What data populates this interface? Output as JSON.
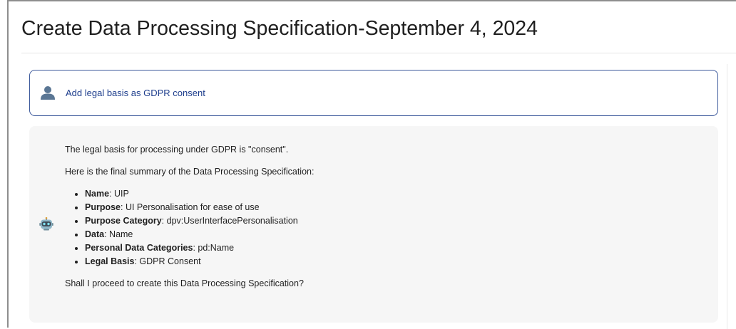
{
  "page": {
    "title": "Create Data Processing Specification-September 4, 2024"
  },
  "user_message": {
    "avatar_icon": "user-silhouette-icon",
    "text": "Add legal basis as GDPR consent"
  },
  "bot_message": {
    "avatar_icon": "robot-icon",
    "intro": "The legal basis for processing under GDPR is \"consent\".",
    "summary_intro": "Here is the final summary of the Data Processing Specification:",
    "items": [
      {
        "label": "Name",
        "value": ": UIP"
      },
      {
        "label": "Purpose",
        "value": ": UI Personalisation for ease of use"
      },
      {
        "label": "Purpose Category",
        "value": ": dpv:UserInterfacePersonalisation"
      },
      {
        "label": "Data",
        "value": ": Name"
      },
      {
        "label": "Personal Data Categories",
        "value": ": pd:Name"
      },
      {
        "label": "Legal Basis",
        "value": ": GDPR Consent"
      }
    ],
    "question": "Shall I proceed to create this Data Processing Specification?"
  },
  "colors": {
    "user_border": "#3d5a9c",
    "user_text": "#1d3d8c",
    "bot_background": "#f6f6f6",
    "page_frame": "#8e8e8e"
  }
}
